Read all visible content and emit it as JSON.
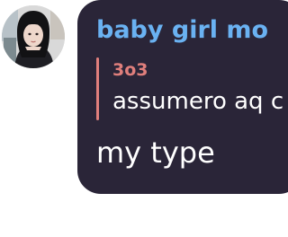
{
  "avatar": {
    "icon": "user-photo-avatar"
  },
  "message": {
    "sender_name": "baby girl mo",
    "reply": {
      "author": "3o3",
      "text": "assumero aq c"
    },
    "text": "my type"
  },
  "colors": {
    "bubble": "#2a2538",
    "sender_name": "#6ab2f2",
    "reply_accent": "#e07f7c",
    "text": "#ffffff"
  }
}
